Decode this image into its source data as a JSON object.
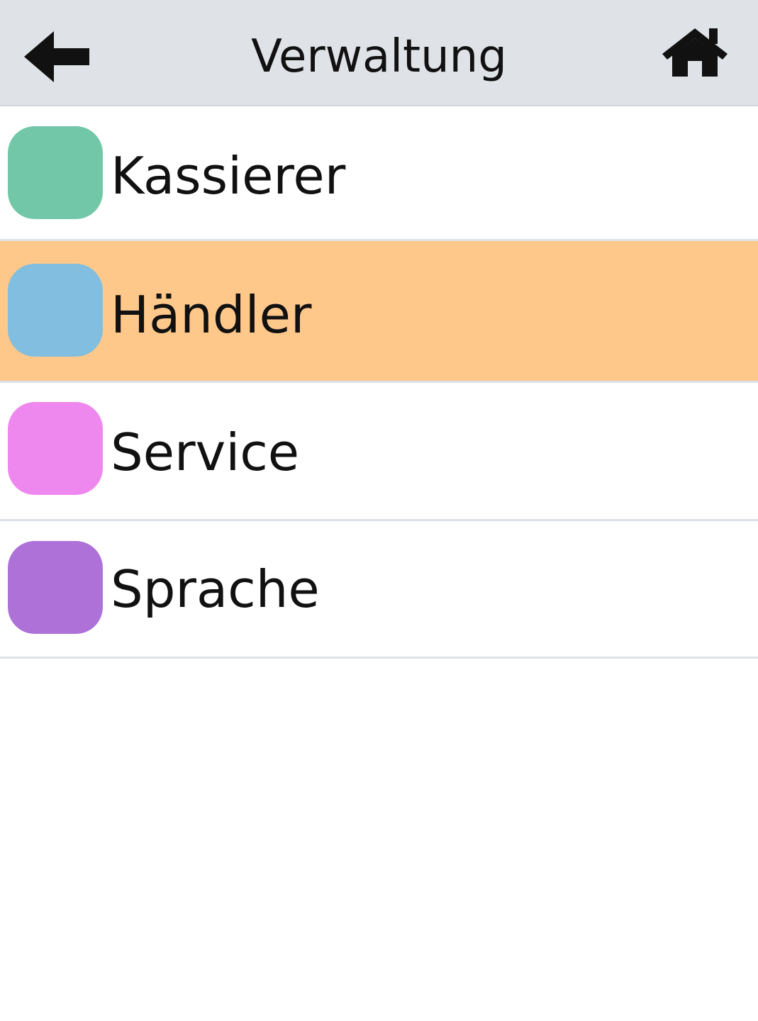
{
  "header": {
    "title": "Verwaltung",
    "back_icon": "arrow-left-icon",
    "home_icon": "home-icon"
  },
  "menu": {
    "items": [
      {
        "label": "Kassierer",
        "color": "#72c7a9",
        "selected": false
      },
      {
        "label": "Händler",
        "color": "#82bedf",
        "selected": true
      },
      {
        "label": "Service",
        "color": "#ef88ee",
        "selected": false
      },
      {
        "label": "Sprache",
        "color": "#ad71d7",
        "selected": false
      }
    ],
    "selected_background": "#fec88b"
  }
}
